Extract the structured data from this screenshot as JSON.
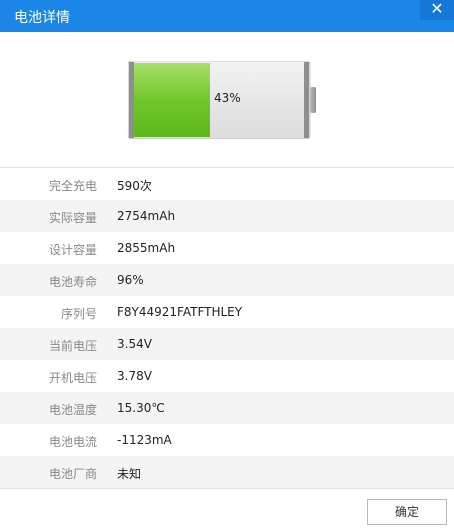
{
  "window": {
    "title": "电池详情",
    "close_glyph": "✕"
  },
  "battery": {
    "percent_label": "43%",
    "level": 0.43,
    "fill_color": "#6dc52a"
  },
  "details": [
    {
      "label": "完全充电",
      "value": "590次"
    },
    {
      "label": "实际容量",
      "value": "2754mAh"
    },
    {
      "label": "设计容量",
      "value": "2855mAh"
    },
    {
      "label": "电池寿命",
      "value": "96%"
    },
    {
      "label": "序列号",
      "value": "F8Y44921FATFTHLEY"
    },
    {
      "label": "当前电压",
      "value": "3.54V"
    },
    {
      "label": "开机电压",
      "value": "3.78V"
    },
    {
      "label": "电池温度",
      "value": "15.30℃"
    },
    {
      "label": "电池电流",
      "value": "-1123mA"
    },
    {
      "label": "电池厂商",
      "value": "未知"
    }
  ],
  "footer": {
    "ok_label": "确定"
  },
  "colors": {
    "titlebar": "#1a87e8",
    "row_alt": "#f4f4f4"
  }
}
